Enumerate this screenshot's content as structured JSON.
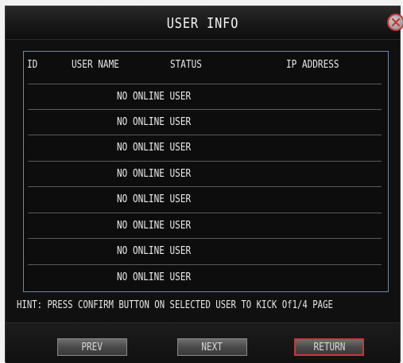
{
  "window": {
    "title": "USER INFO"
  },
  "columns": {
    "id": "ID",
    "user_name": "USER NAME",
    "status": "STATUS",
    "ip_address": "IP ADDRESS"
  },
  "rows": [
    {
      "text": "NO ONLINE USER"
    },
    {
      "text": "NO ONLINE USER"
    },
    {
      "text": "NO ONLINE USER"
    },
    {
      "text": "NO ONLINE USER"
    },
    {
      "text": "NO ONLINE USER"
    },
    {
      "text": "NO ONLINE USER"
    },
    {
      "text": "NO ONLINE USER"
    },
    {
      "text": "NO ONLINE USER"
    }
  ],
  "hint": "HINT: PRESS CONFIRM BUTTON ON SELECTED USER TO KICK Of1/4 PAGE",
  "buttons": {
    "prev": "PREV",
    "next": "NEXT",
    "return": "RETURN"
  },
  "icons": {
    "close": "close-icon"
  },
  "colors": {
    "panel_border": "#6f87a6",
    "return_border": "#c43a3a",
    "close_ring": "#c63636"
  }
}
